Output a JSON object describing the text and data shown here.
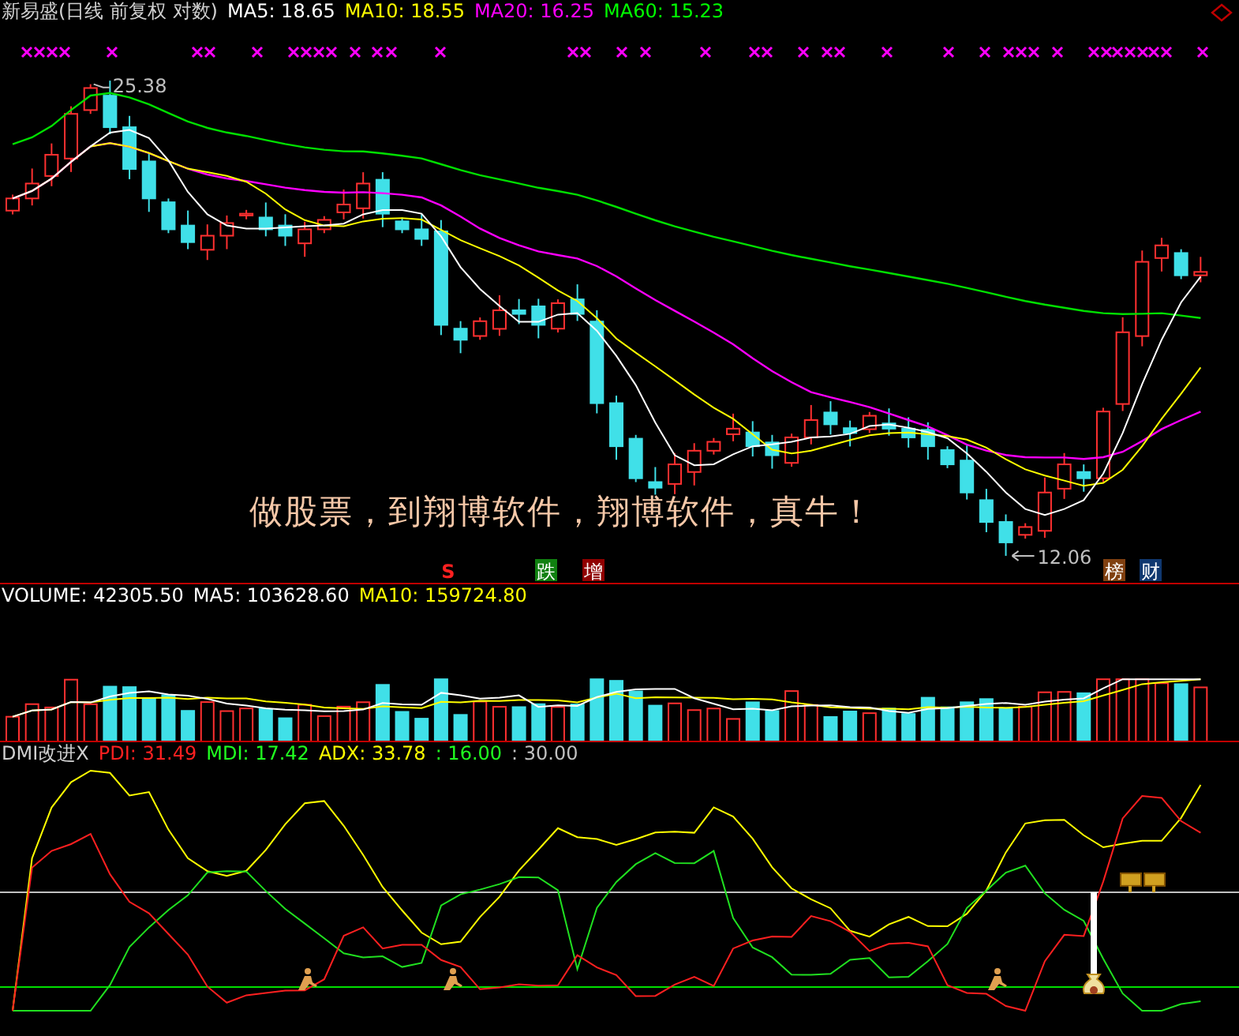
{
  "header": {
    "title": "新易盛(日线 前复权 对数)",
    "indicators": [
      {
        "label": "MA5: 18.65",
        "color": "#ffffff"
      },
      {
        "label": "MA10: 18.55",
        "color": "#ffff00"
      },
      {
        "label": "MA20: 16.25",
        "color": "#ff00ff"
      },
      {
        "label": "MA60: 15.23",
        "color": "#00ff00"
      }
    ]
  },
  "main_chart": {
    "high_label": "25.38",
    "low_label": "12.06",
    "caption": "做股票，到翔博软件，翔博软件，真牛！",
    "markers": [
      {
        "label": "S",
        "kind": "text",
        "color": "#ff2020"
      },
      {
        "label": "跌",
        "kind": "tag",
        "color": "#108010"
      },
      {
        "label": "增",
        "kind": "tag",
        "color": "#900000"
      },
      {
        "label": "榜",
        "kind": "tag",
        "color": "#804010"
      },
      {
        "label": "财",
        "kind": "tag",
        "color": "#103870"
      }
    ]
  },
  "volume": {
    "indicators": [
      {
        "label": "VOLUME: 42305.50",
        "color": "#ffffff"
      },
      {
        "label": "MA5: 103628.60",
        "color": "#ffffff"
      },
      {
        "label": "MA10: 159724.80",
        "color": "#ffff00"
      }
    ]
  },
  "dmi": {
    "title": "DMI改进X",
    "indicators": [
      {
        "label": "PDI: 31.49",
        "color": "#ff2020"
      },
      {
        "label": "MDI: 17.42",
        "color": "#20ff20"
      },
      {
        "label": "ADX: 33.78",
        "color": "#ffff00"
      },
      {
        "label": ": 16.00",
        "color": "#20ff20"
      },
      {
        "label": ": 30.00",
        "color": "#c0c0c0"
      }
    ]
  }
}
